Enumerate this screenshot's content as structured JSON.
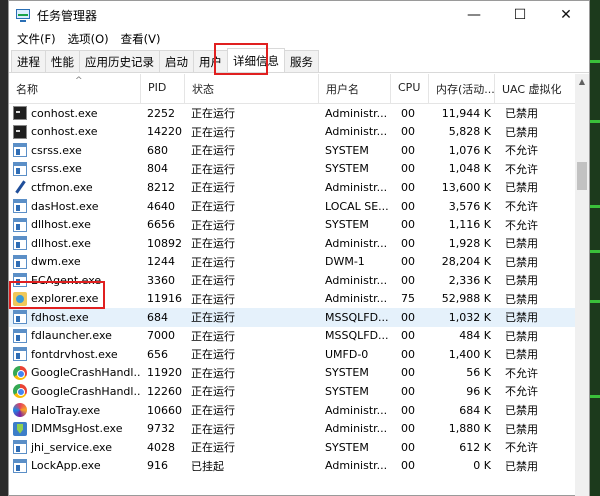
{
  "window": {
    "title": "任务管理器",
    "minimize_label": "—",
    "maximize_label": "☐",
    "close_label": "✕"
  },
  "menu": [
    "文件(F)",
    "选项(O)",
    "查看(V)"
  ],
  "tabs": [
    "进程",
    "性能",
    "应用历史记录",
    "启动",
    "用户",
    "详细信息",
    "服务"
  ],
  "active_tab": "详细信息",
  "columns": {
    "name": "名称",
    "pid": "PID",
    "status": "状态",
    "user": "用户名",
    "cpu": "CPU",
    "memory": "内存(活动...",
    "uac": "UAC 虚拟化"
  },
  "rows": [
    {
      "icon": "console-icon",
      "name": "conhost.exe",
      "pid": "2252",
      "status": "正在运行",
      "user": "Administr...",
      "cpu": "00",
      "mem": "11,944 K",
      "uac": "已禁用"
    },
    {
      "icon": "console-icon",
      "name": "conhost.exe",
      "pid": "14220",
      "status": "正在运行",
      "user": "Administr...",
      "cpu": "00",
      "mem": "5,828 K",
      "uac": "已禁用"
    },
    {
      "icon": "app-icon",
      "name": "csrss.exe",
      "pid": "680",
      "status": "正在运行",
      "user": "SYSTEM",
      "cpu": "00",
      "mem": "1,076 K",
      "uac": "不允许"
    },
    {
      "icon": "app-icon",
      "name": "csrss.exe",
      "pid": "804",
      "status": "正在运行",
      "user": "SYSTEM",
      "cpu": "00",
      "mem": "1,048 K",
      "uac": "不允许"
    },
    {
      "icon": "pen-icon",
      "name": "ctfmon.exe",
      "pid": "8212",
      "status": "正在运行",
      "user": "Administr...",
      "cpu": "00",
      "mem": "13,600 K",
      "uac": "已禁用"
    },
    {
      "icon": "app-icon",
      "name": "dasHost.exe",
      "pid": "4640",
      "status": "正在运行",
      "user": "LOCAL SE...",
      "cpu": "00",
      "mem": "3,576 K",
      "uac": "不允许"
    },
    {
      "icon": "app-icon",
      "name": "dllhost.exe",
      "pid": "6656",
      "status": "正在运行",
      "user": "SYSTEM",
      "cpu": "00",
      "mem": "1,116 K",
      "uac": "不允许"
    },
    {
      "icon": "app-icon",
      "name": "dllhost.exe",
      "pid": "10892",
      "status": "正在运行",
      "user": "Administr...",
      "cpu": "00",
      "mem": "1,928 K",
      "uac": "已禁用"
    },
    {
      "icon": "app-icon",
      "name": "dwm.exe",
      "pid": "1244",
      "status": "正在运行",
      "user": "DWM-1",
      "cpu": "00",
      "mem": "28,204 K",
      "uac": "已禁用"
    },
    {
      "icon": "app-icon",
      "name": "ECAgent.exe",
      "pid": "3360",
      "status": "正在运行",
      "user": "Administr...",
      "cpu": "00",
      "mem": "2,336 K",
      "uac": "已禁用"
    },
    {
      "icon": "folder-icon",
      "name": "explorer.exe",
      "pid": "11916",
      "status": "正在运行",
      "user": "Administr...",
      "cpu": "75",
      "mem": "52,988 K",
      "uac": "已禁用"
    },
    {
      "icon": "app-icon",
      "name": "fdhost.exe",
      "pid": "684",
      "status": "正在运行",
      "user": "MSSQLFD...",
      "cpu": "00",
      "mem": "1,032 K",
      "uac": "已禁用",
      "selected": true
    },
    {
      "icon": "app-icon",
      "name": "fdlauncher.exe",
      "pid": "7000",
      "status": "正在运行",
      "user": "MSSQLFD...",
      "cpu": "00",
      "mem": "484 K",
      "uac": "已禁用"
    },
    {
      "icon": "app-icon",
      "name": "fontdrvhost.exe",
      "pid": "656",
      "status": "正在运行",
      "user": "UMFD-0",
      "cpu": "00",
      "mem": "1,400 K",
      "uac": "已禁用"
    },
    {
      "icon": "gcrash-icon",
      "name": "GoogleCrashHandl...",
      "pid": "11920",
      "status": "正在运行",
      "user": "SYSTEM",
      "cpu": "00",
      "mem": "56 K",
      "uac": "不允许"
    },
    {
      "icon": "gcrash-icon",
      "name": "GoogleCrashHandl...",
      "pid": "12260",
      "status": "正在运行",
      "user": "SYSTEM",
      "cpu": "00",
      "mem": "96 K",
      "uac": "不允许"
    },
    {
      "icon": "halo-icon",
      "name": "HaloTray.exe",
      "pid": "10660",
      "status": "正在运行",
      "user": "Administr...",
      "cpu": "00",
      "mem": "684 K",
      "uac": "已禁用"
    },
    {
      "icon": "idm-icon",
      "name": "IDMMsgHost.exe",
      "pid": "9732",
      "status": "正在运行",
      "user": "Administr...",
      "cpu": "00",
      "mem": "1,880 K",
      "uac": "已禁用"
    },
    {
      "icon": "app-icon",
      "name": "jhi_service.exe",
      "pid": "4028",
      "status": "正在运行",
      "user": "SYSTEM",
      "cpu": "00",
      "mem": "612 K",
      "uac": "不允许"
    },
    {
      "icon": "app-icon",
      "name": "LockApp.exe",
      "pid": "916",
      "status": "已挂起",
      "user": "Administr...",
      "cpu": "00",
      "mem": "0 K",
      "uac": "已禁用"
    }
  ]
}
